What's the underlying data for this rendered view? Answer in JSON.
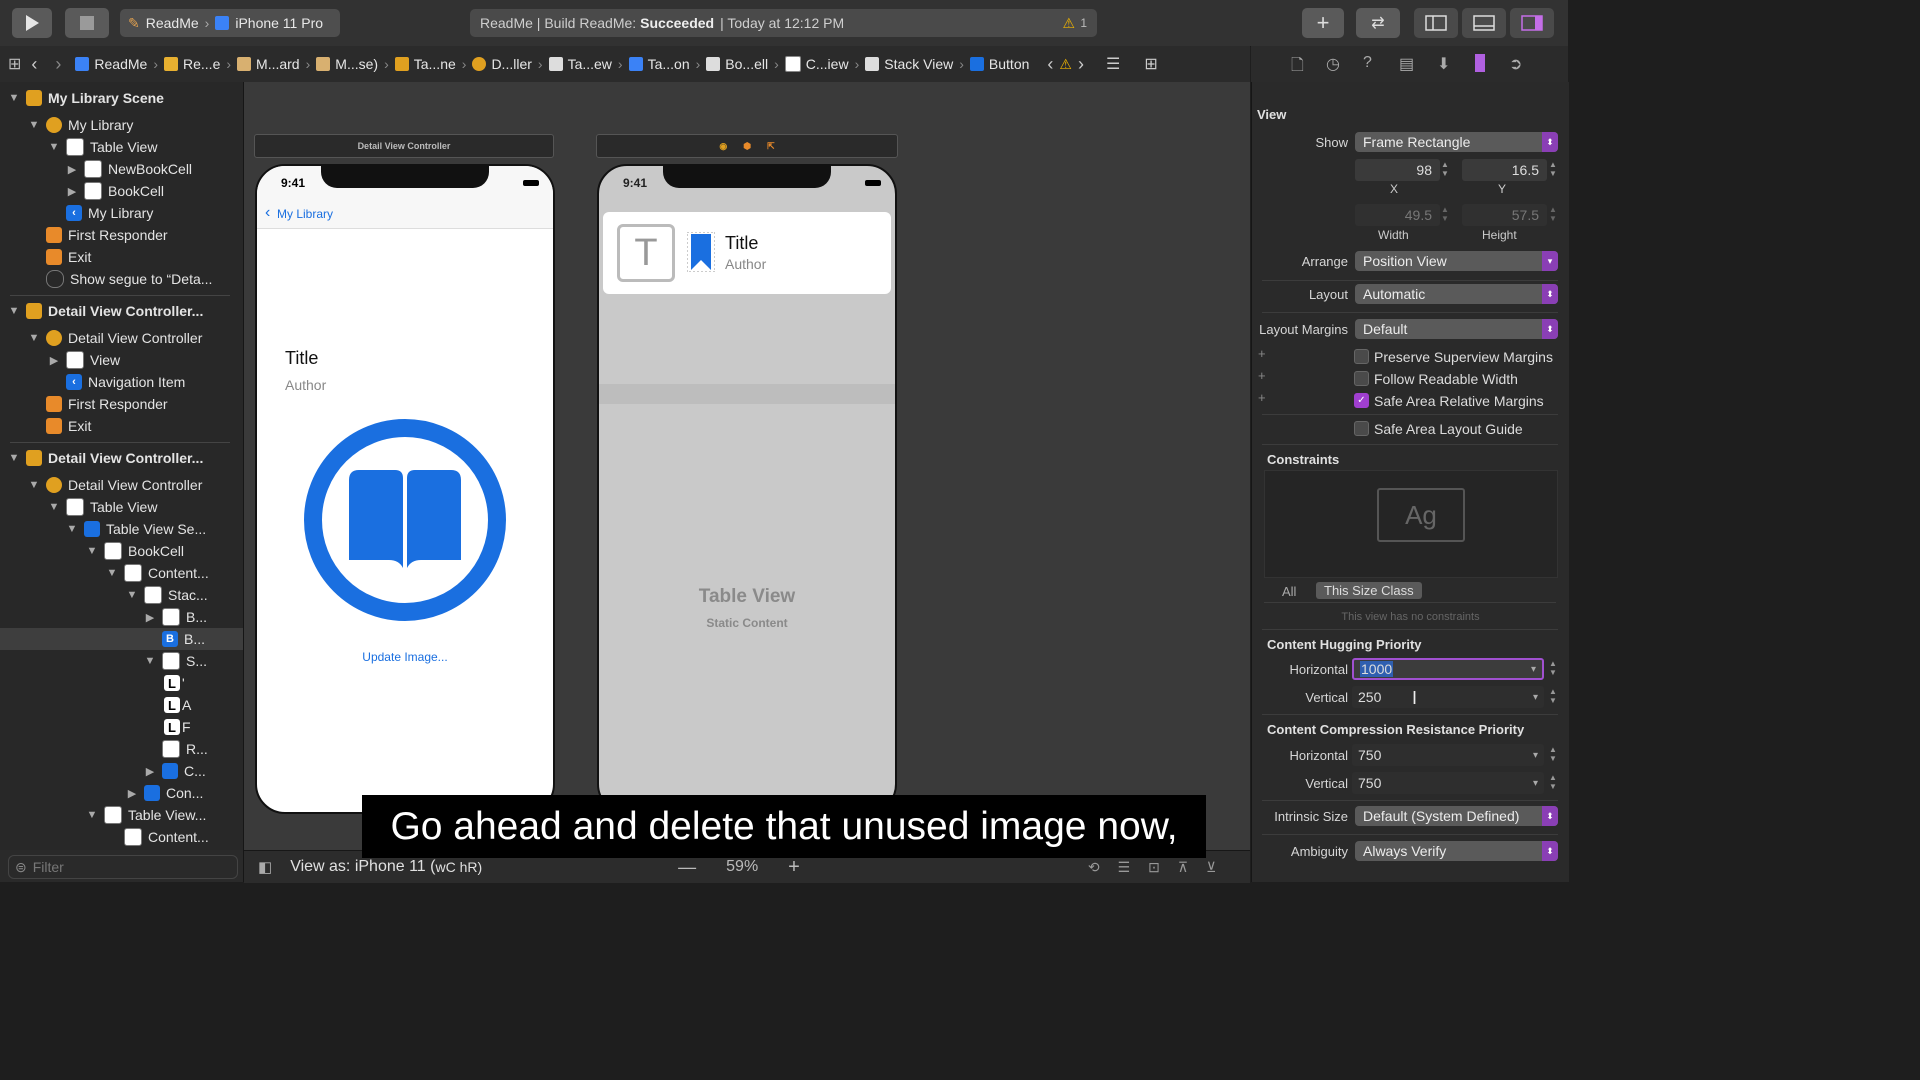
{
  "toolbar": {
    "scheme_app": "ReadMe",
    "scheme_device": "iPhone 11 Pro",
    "status_prefix": "ReadMe | Build ReadMe: ",
    "status_result": "Succeeded",
    "status_time": "| Today at 12:12 PM",
    "warning_count": "1"
  },
  "jumpbar": {
    "crumbs": [
      "ReadMe",
      "Re...e",
      "M...ard",
      "M...se)",
      "Ta...ne",
      "D...ller",
      "Ta...ew",
      "Ta...on",
      "Bo...ell",
      "C...iew",
      "Stack View",
      "Button"
    ]
  },
  "navigator": {
    "items": [
      {
        "label": "My Library Scene"
      },
      {
        "label": "My Library"
      },
      {
        "label": "Table View"
      },
      {
        "label": "NewBookCell"
      },
      {
        "label": "BookCell"
      },
      {
        "label": "My Library"
      },
      {
        "label": "First Responder"
      },
      {
        "label": "Exit"
      },
      {
        "label": "Show segue to “Deta..."
      },
      {
        "label": "Detail View Controller..."
      },
      {
        "label": "Detail View Controller"
      },
      {
        "label": "View"
      },
      {
        "label": "Navigation Item"
      },
      {
        "label": "First Responder"
      },
      {
        "label": "Exit"
      },
      {
        "label": "Detail View Controller..."
      },
      {
        "label": "Detail View Controller"
      },
      {
        "label": "Table View"
      },
      {
        "label": "Table View Se..."
      },
      {
        "label": "BookCell"
      },
      {
        "label": "Content..."
      },
      {
        "label": "Stac..."
      },
      {
        "label": "B..."
      },
      {
        "label": "B..."
      },
      {
        "label": "S..."
      },
      {
        "label": "'"
      },
      {
        "label": "A"
      },
      {
        "label": "F"
      },
      {
        "label": "R..."
      },
      {
        "label": "C..."
      },
      {
        "label": "Con..."
      },
      {
        "label": "Table View..."
      },
      {
        "label": "Content..."
      }
    ],
    "filter_placeholder": "Filter"
  },
  "canvas": {
    "scene1_header": "Detail View Controller",
    "phone1": {
      "time": "9:41",
      "back_label": "My Library",
      "title": "Title",
      "author": "Author",
      "update_label": "Update Image..."
    },
    "phone2": {
      "time": "9:41",
      "cell_title": "Title",
      "cell_author": "Author",
      "cell_letter": "T",
      "table_label": "Table View",
      "table_sub": "Static Content"
    },
    "view_as": "View as: iPhone 11 (",
    "view_as_suffix": "wC hR)",
    "zoom": "59%"
  },
  "inspector": {
    "section_view": "View",
    "show_label": "Show",
    "show_value": "Frame Rectangle",
    "x_value": "98",
    "y_value": "16.5",
    "x_label": "X",
    "y_label": "Y",
    "width_value": "49.5",
    "height_value": "57.5",
    "width_label": "Width",
    "height_label": "Height",
    "arrange_label": "Arrange",
    "arrange_value": "Position View",
    "layout_label": "Layout",
    "layout_value": "Automatic",
    "margins_label": "Layout Margins",
    "margins_value": "Default",
    "preserve_label": "Preserve Superview Margins",
    "readable_label": "Follow Readable Width",
    "safearea_rel_label": "Safe Area Relative Margins",
    "safearea_guide_label": "Safe Area Layout Guide",
    "constraints_title": "Constraints",
    "constraints_preview": "Ag",
    "tab_all": "All",
    "tab_size_class": "This Size Class",
    "no_constraints": "This view has no constraints",
    "hugging_title": "Content Hugging Priority",
    "hug_h_label": "Horizontal",
    "hug_h_value": "1000",
    "hug_v_label": "Vertical",
    "hug_v_value": "250",
    "compression_title": "Content Compression Resistance Priority",
    "comp_h_label": "Horizontal",
    "comp_h_value": "750",
    "comp_v_label": "Vertical",
    "comp_v_value": "750",
    "intrinsic_label": "Intrinsic Size",
    "intrinsic_value": "Default (System Defined)",
    "ambiguity_label": "Ambiguity",
    "ambiguity_value": "Always Verify"
  },
  "subtitle": "Go ahead and delete that unused image now,"
}
